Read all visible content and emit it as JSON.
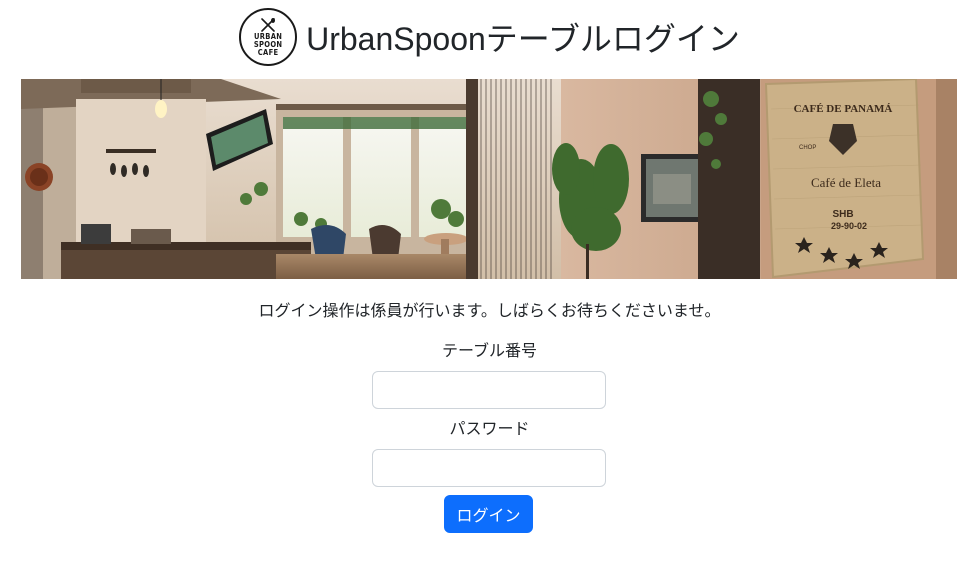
{
  "header": {
    "title": "UrbanSpoonテーブルログイン",
    "logo_lines": [
      "URBAN",
      "SPOON",
      "CAFE"
    ]
  },
  "banner": {
    "sign_line1": "CAFÉ DE PANAMÁ",
    "sign_line2": "CHOP",
    "sign_line3": "Café de Eleta",
    "sign_line4": "SHB",
    "sign_line5": "29-90-02",
    "icon": "cafe-interior-photo"
  },
  "notice": "ログイン操作は係員が行います。しばらくお待ちくださいませ。",
  "form": {
    "table_number_label": "テーブル番号",
    "table_number_value": "",
    "password_label": "パスワード",
    "password_value": "",
    "login_button": "ログイン"
  },
  "colors": {
    "primary": "#0d6efd",
    "text": "#212529",
    "input_border": "#ced4da"
  }
}
